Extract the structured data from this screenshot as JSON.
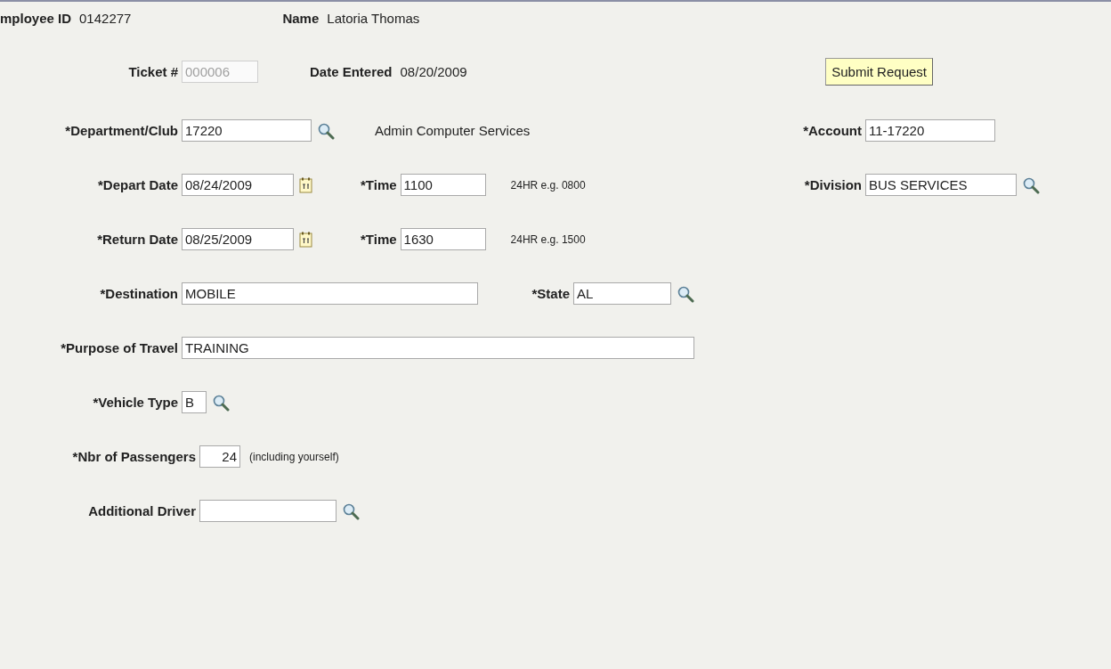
{
  "header": [
    {
      "label": "mployee ID",
      "value": "0142277"
    },
    {
      "label": "Name",
      "value": "Latoria Thomas"
    }
  ],
  "ticket": {
    "label": "Ticket #",
    "value": "000006",
    "disabled": true
  },
  "date_entered": {
    "label": "Date Entered",
    "value": "08/20/2009"
  },
  "submit_button": "Submit Request",
  "rows": [
    {
      "items": [
        {
          "kind": "lookup",
          "label": "*Department/Club",
          "value": "17220"
        },
        {
          "kind": "text",
          "text": "Admin Computer Services"
        }
      ],
      "side": {
        "kind": "plain",
        "label": "*Account",
        "value": "11-17220"
      }
    },
    {
      "items": [
        {
          "kind": "date",
          "label": "*Depart Date",
          "value": "08/24/2009"
        },
        {
          "kind": "plain",
          "label": "*Time",
          "value": "1100"
        },
        {
          "kind": "note",
          "text": "24HR e.g. 0800"
        }
      ],
      "side": {
        "kind": "lookup",
        "label": "*Division",
        "value": "BUS SERVICES"
      }
    },
    {
      "items": [
        {
          "kind": "date",
          "label": "*Return Date",
          "value": "08/25/2009"
        },
        {
          "kind": "plain",
          "label": "*Time",
          "value": "1630"
        },
        {
          "kind": "note",
          "text": "24HR e.g. 1500"
        }
      ]
    },
    {
      "items": [
        {
          "kind": "plain",
          "label": "*Destination",
          "value": "MOBILE"
        },
        {
          "kind": "lookup",
          "label": "*State",
          "value": "AL"
        }
      ]
    },
    {
      "items": [
        {
          "kind": "plain",
          "label": "*Purpose of Travel",
          "value": "TRAINING"
        }
      ]
    },
    {
      "items": [
        {
          "kind": "lookup",
          "label": "*Vehicle Type",
          "value": "B"
        }
      ]
    },
    {
      "items": [
        {
          "kind": "number",
          "label": "*Nbr of Passengers",
          "value": "24"
        },
        {
          "kind": "note",
          "text": "(including yourself)"
        }
      ]
    },
    {
      "items": [
        {
          "kind": "lookup",
          "label": "Additional Driver",
          "value": ""
        }
      ]
    }
  ]
}
